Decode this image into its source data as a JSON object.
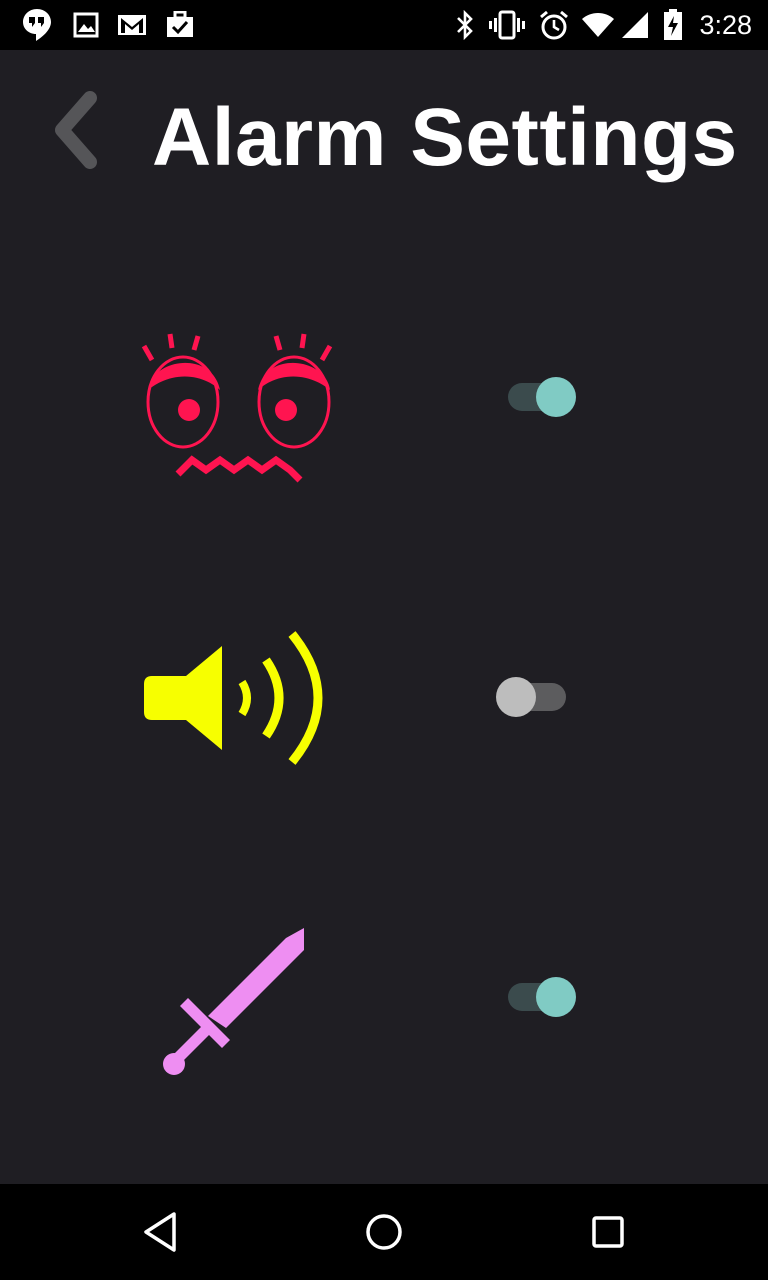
{
  "status_bar": {
    "time": "3:28",
    "left_icons": [
      "hangouts-icon",
      "image-icon",
      "gmail-icon",
      "tasks-icon"
    ],
    "right_icons": [
      "bluetooth-icon",
      "vibrate-icon",
      "alarm-icon",
      "wifi-icon",
      "signal-icon",
      "battery-charging-icon"
    ]
  },
  "header": {
    "title": "Alarm Settings",
    "back_icon": "chevron-left-icon"
  },
  "settings": [
    {
      "icon": "angry-face-icon",
      "color": "#ff1450",
      "enabled": true
    },
    {
      "icon": "speaker-volume-icon",
      "color": "#f7ff00",
      "enabled": false
    },
    {
      "icon": "sword-icon",
      "color": "#ee8ef2",
      "enabled": true
    }
  ],
  "colors": {
    "background": "#1f1e23",
    "toggle_on_thumb": "#80cbc4",
    "toggle_on_track": "#3b4b4d",
    "toggle_off_thumb": "#bdbdbd",
    "toggle_off_track": "#5c5c5e"
  },
  "nav_bar": {
    "buttons": [
      "back-triangle-icon",
      "home-circle-icon",
      "recents-square-icon"
    ]
  }
}
